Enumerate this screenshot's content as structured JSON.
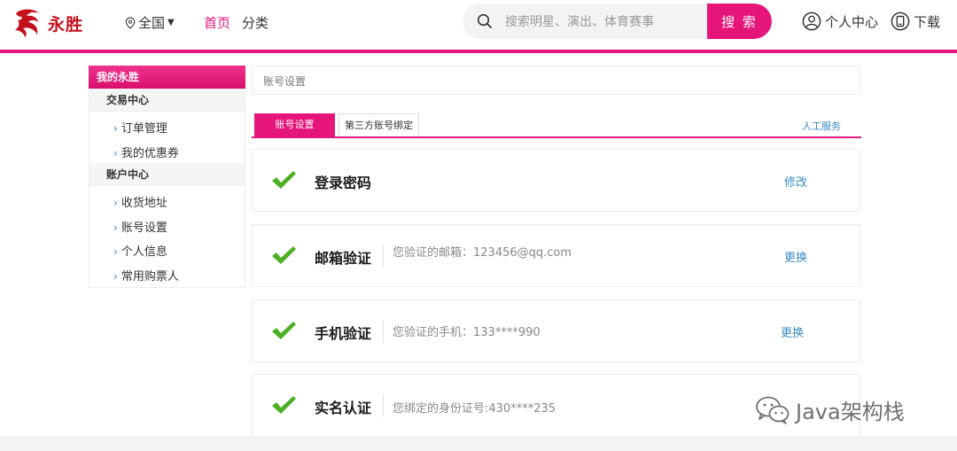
{
  "header": {
    "logo_text": "永胜",
    "city": "全国",
    "nav": {
      "home": "首页",
      "category": "分类"
    },
    "search": {
      "placeholder": "搜索明星、演出、体育赛事",
      "button": "搜 索"
    },
    "user_center": "个人中心",
    "download": "下载"
  },
  "sidebar": {
    "title": "我的永胜",
    "groups": [
      {
        "label": "交易中心",
        "items": [
          "订单管理",
          "我的优惠券"
        ]
      },
      {
        "label": "账户中心",
        "items": [
          "收货地址",
          "账号设置",
          "个人信息",
          "常用购票人"
        ]
      }
    ]
  },
  "breadcrumb": "账号设置",
  "tabs": [
    {
      "label": "账号设置",
      "active": true
    },
    {
      "label": "第三方账号绑定",
      "active": false
    }
  ],
  "service_link": "人工服务",
  "settings": [
    {
      "title": "登录密码",
      "desc": "",
      "action": "修改"
    },
    {
      "title": "邮箱验证",
      "desc": "您验证的邮箱：123456@qq.com",
      "action": "更换"
    },
    {
      "title": "手机验证",
      "desc": "您验证的手机：133****990",
      "action": "更换"
    },
    {
      "title": "实名认证",
      "desc": "您绑定的身份证号:430****235",
      "action": ""
    }
  ],
  "watermark": "Java架构栈",
  "colors": {
    "accent": "#e6157a",
    "link": "#3b8ac6",
    "check": "#4caf24",
    "logo": "#c4101c"
  }
}
